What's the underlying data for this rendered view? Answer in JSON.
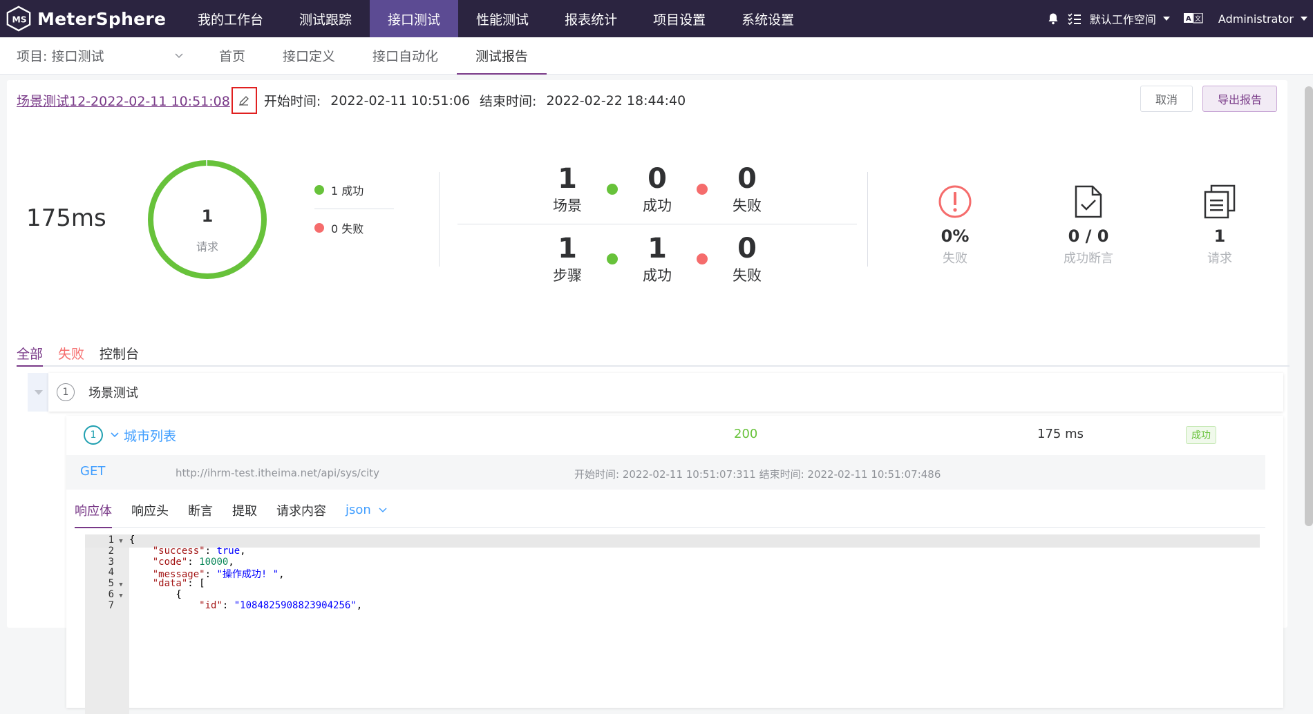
{
  "topbar": {
    "brand": "MeterSphere",
    "nav": [
      "我的工作台",
      "测试跟踪",
      "接口测试",
      "性能测试",
      "报表统计",
      "项目设置",
      "系统设置"
    ],
    "active_index": 2,
    "workspace": "默认工作空间",
    "user": "Administrator",
    "lang_icon_text": "A文"
  },
  "subbar": {
    "project": "项目: 接口测试",
    "nav": [
      "首页",
      "接口定义",
      "接口自动化",
      "测试报告"
    ],
    "active_index": 3
  },
  "report": {
    "title": "场景测试12-2022-02-11 10:51:08",
    "start_label": "开始时间:",
    "start_value": "2022-02-11 10:51:06",
    "end_label": "结束时间:",
    "end_value": "2022-02-22 18:44:40",
    "cancel_label": "取消",
    "export_label": "导出报告"
  },
  "summary": {
    "duration": "175ms",
    "ring_value": "1",
    "ring_label": "请求",
    "ring_success_ratio": 1.0,
    "legend_success": "1 成功",
    "legend_fail": "0 失败",
    "scenario": {
      "total": "1",
      "total_label": "场景",
      "success": "0",
      "success_label": "成功",
      "fail": "0",
      "fail_label": "失败"
    },
    "step": {
      "total": "1",
      "total_label": "步骤",
      "success": "1",
      "success_label": "成功",
      "fail": "0",
      "fail_label": "失败"
    },
    "kpi_fail_value": "0%",
    "kpi_fail_label": "失败",
    "kpi_assert_value": "0 / 0",
    "kpi_assert_label": "成功断言",
    "kpi_req_value": "1",
    "kpi_req_label": "请求"
  },
  "tabs": [
    "全部",
    "失败",
    "控制台"
  ],
  "scenario_row": {
    "index": "1",
    "name": "场景测试"
  },
  "api_row": {
    "index": "1",
    "name": "城市列表",
    "status_code": "200",
    "time": "175 ms",
    "badge": "成功",
    "method": "GET",
    "url": "http://ihrm-test.itheima.net/api/sys/city",
    "times": "开始时间: 2022-02-11 10:51:07:311 结束时间: 2022-02-11 10:51:07:486"
  },
  "response_tabs": [
    "响应体",
    "响应头",
    "断言",
    "提取",
    "请求内容"
  ],
  "format": "json",
  "code_lines": [
    {
      "n": "1",
      "fold": true,
      "text": "{"
    },
    {
      "n": "2",
      "fold": false,
      "text": "    \"success\": true,"
    },
    {
      "n": "3",
      "fold": false,
      "text": "    \"code\": 10000,"
    },
    {
      "n": "4",
      "fold": false,
      "text": "    \"message\": \"操作成功! \","
    },
    {
      "n": "5",
      "fold": true,
      "text": "    \"data\": ["
    },
    {
      "n": "6",
      "fold": true,
      "text": "        {"
    },
    {
      "n": "7",
      "fold": false,
      "text": "            \"id\": \"1084825908823904256\","
    }
  ],
  "colors": {
    "accent": "#783887",
    "topbar": "#2b2440",
    "success": "#67c23a",
    "fail": "#f56c6c",
    "link": "#409eff"
  }
}
